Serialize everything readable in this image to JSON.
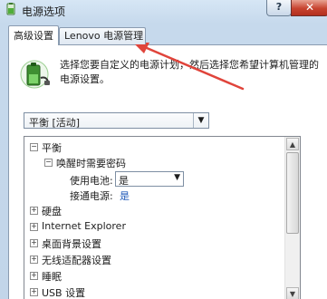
{
  "window": {
    "title": "电源选项",
    "help_label": "?",
    "close_label": "✕"
  },
  "tabs": [
    {
      "label": "高级设置"
    },
    {
      "label": "Lenovo 电源管理"
    }
  ],
  "intro_text": "选择您要自定义的电源计划，然后选择您希望计算机管理的电源设置。",
  "plan_select": {
    "value": "平衡 [活动]",
    "arrow": "▼"
  },
  "tree": {
    "root": {
      "toggle": "⊟",
      "label": "平衡"
    },
    "wake_password": {
      "toggle": "⊟",
      "label": "唤醒时需要密码"
    },
    "on_battery": {
      "label": "使用电池:",
      "value": "是",
      "arrow": "▼"
    },
    "plugged_in": {
      "label": "接通电源:",
      "value": "是"
    },
    "items": [
      {
        "toggle": "⊞",
        "label": "硬盘"
      },
      {
        "toggle": "⊞",
        "label": "Internet Explorer"
      },
      {
        "toggle": "⊞",
        "label": "桌面背景设置"
      },
      {
        "toggle": "⊞",
        "label": "无线适配器设置"
      },
      {
        "toggle": "⊞",
        "label": "睡眠"
      },
      {
        "toggle": "⊞",
        "label": "USB 设置"
      }
    ]
  },
  "scrollbar": {
    "up": "▲",
    "down": "▼"
  },
  "colors": {
    "annotation_arrow": "#e0443b",
    "link_blue": "#1d57b8"
  }
}
